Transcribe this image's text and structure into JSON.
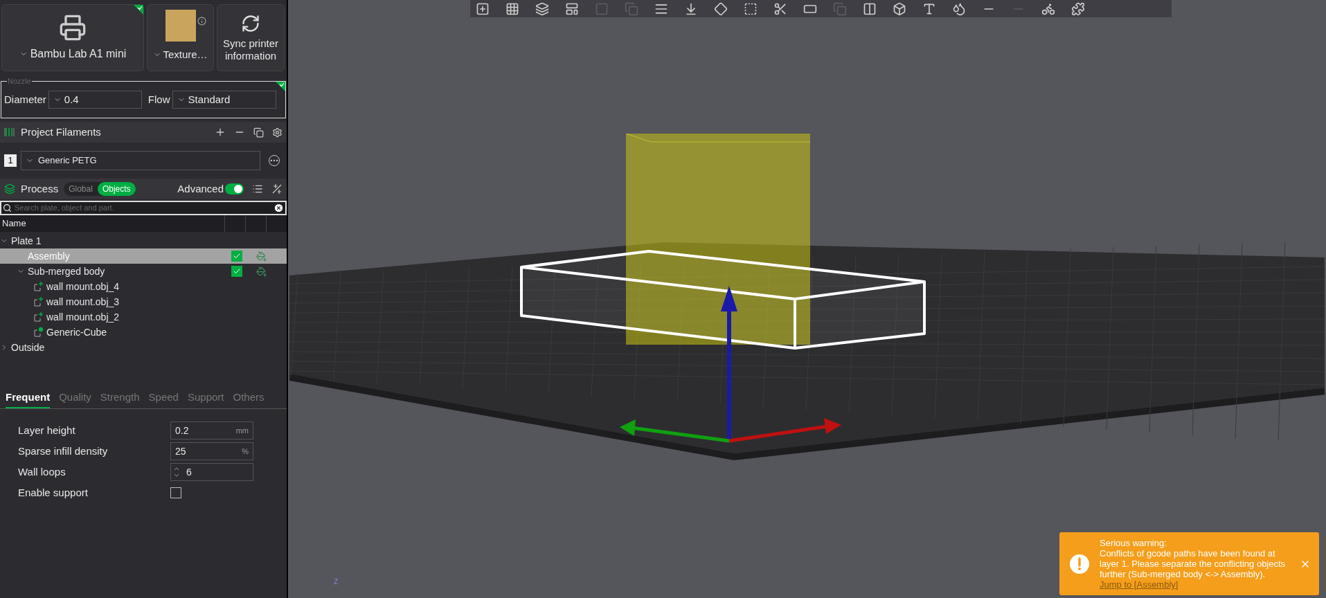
{
  "printer": {
    "name": "Bambu Lab A1 mini",
    "synced": true,
    "plate": "Texture…",
    "sync_button": "Sync printer information"
  },
  "nozzle": {
    "legend": "Nozzle",
    "synced": true,
    "diameter_label": "Diameter",
    "diameter_value": "0.4",
    "flow_label": "Flow",
    "flow_value": "Standard"
  },
  "filaments": {
    "title": "Project Filaments",
    "items": [
      {
        "index": "1",
        "name": "Generic PETG"
      }
    ]
  },
  "process": {
    "title": "Process",
    "scope_tabs": [
      {
        "label": "Global",
        "selected": false
      },
      {
        "label": "Objects",
        "selected": true
      }
    ],
    "advanced": {
      "label": "Advanced",
      "on": true
    }
  },
  "search": {
    "placeholder": "Search plate, object and part."
  },
  "object_list": {
    "columns": [
      {
        "label": "Name"
      }
    ],
    "tree": [
      {
        "name": "Plate 1",
        "expanded": true,
        "selected": false,
        "children": [
          {
            "name": "Assembly",
            "selected": true,
            "printable": true
          },
          {
            "name": "Sub-merged body",
            "expanded": true,
            "selected": false,
            "printable": true,
            "children": [
              {
                "name": "wall mount.obj_4",
                "kind": "part",
                "selected": false
              },
              {
                "name": "wall mount.obj_3",
                "kind": "part",
                "selected": false
              },
              {
                "name": "wall mount.obj_2",
                "kind": "part",
                "selected": false
              },
              {
                "name": "Generic-Cube",
                "kind": "modifier",
                "selected": false
              }
            ]
          }
        ]
      },
      {
        "name": "Outside",
        "expanded": false,
        "selected": false
      }
    ]
  },
  "settings_tabs": [
    {
      "label": "Frequent",
      "selected": true
    },
    {
      "label": "Quality",
      "selected": false
    },
    {
      "label": "Strength",
      "selected": false
    },
    {
      "label": "Speed",
      "selected": false
    },
    {
      "label": "Support",
      "selected": false
    },
    {
      "label": "Others",
      "selected": false
    }
  ],
  "settings": [
    {
      "kind": "number",
      "label": "Layer height",
      "value": "0.2",
      "unit": "mm"
    },
    {
      "kind": "number",
      "label": "Sparse infill density",
      "value": "25",
      "unit": "%"
    },
    {
      "kind": "spin",
      "label": "Wall loops",
      "value": "6"
    },
    {
      "kind": "checkbox",
      "label": "Enable support",
      "checked": false
    }
  ],
  "viewport": {
    "axis_label": "Z"
  },
  "warning": {
    "title": "Serious warning:",
    "message": "Conflicts of gcode paths have been found at layer 1. Please separate the conflicting objects further (Sub-merged body <-> Assembly).",
    "link": "Jump to [Assembly]"
  }
}
